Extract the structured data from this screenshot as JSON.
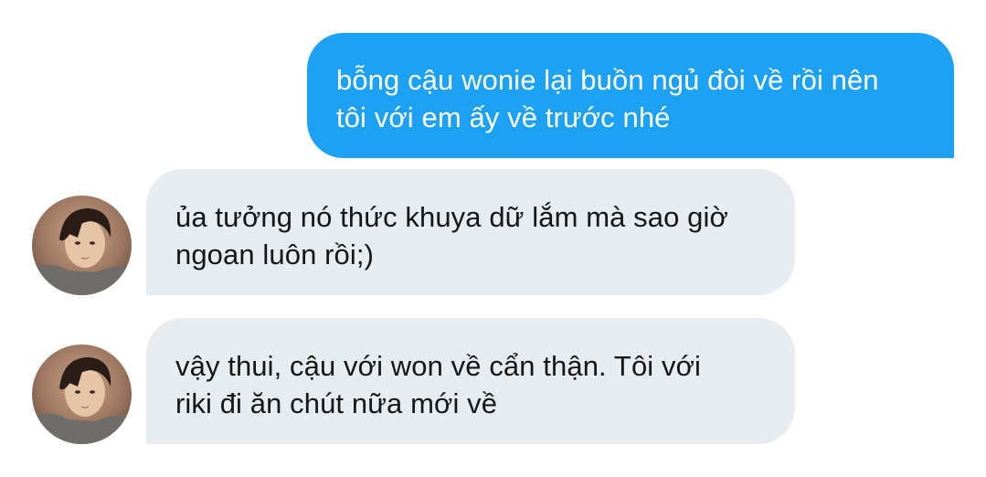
{
  "conversation": {
    "messages": [
      {
        "direction": "outgoing",
        "lines": [
          "bỗng cậu wonie lại buồn ngủ đòi về rồi nên",
          "tôi với em ấy về trước nhé"
        ]
      },
      {
        "direction": "incoming",
        "avatar_icon": "profile-photo",
        "lines": [
          "ủa tưởng nó thức khuya dữ lắm mà sao giờ",
          "ngoan luôn rồi;)"
        ]
      },
      {
        "direction": "incoming",
        "avatar_icon": "profile-photo",
        "lines": [
          "vậy thui, cậu với won về cẩn thận. Tôi với",
          "riki đi ăn chút nữa mới về"
        ]
      }
    ]
  },
  "colors": {
    "outgoing_bubble": "#1da1f2",
    "incoming_bubble": "#e6ecf0",
    "outgoing_text": "#ffffff",
    "incoming_text": "#14171a"
  }
}
